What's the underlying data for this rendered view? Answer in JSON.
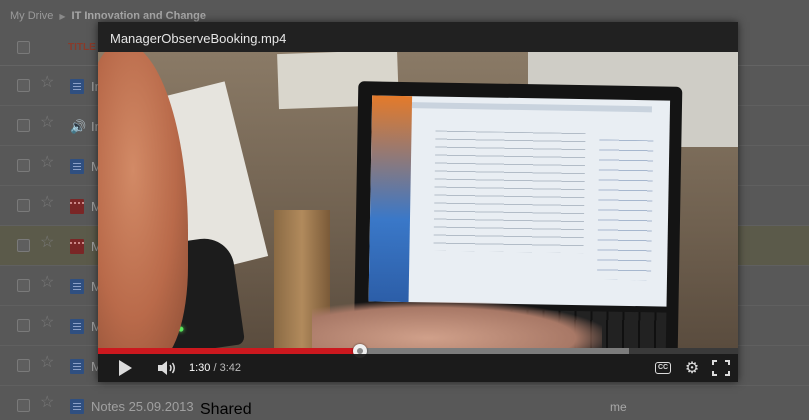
{
  "drive": {
    "breadcrumb": {
      "root": "My Drive",
      "folder": "IT Innovation and Change"
    },
    "columns": {
      "title": "TITLE"
    },
    "rows": [
      {
        "type": "doc",
        "name": "In",
        "shared": "",
        "owner": ""
      },
      {
        "type": "audio",
        "name": "In",
        "shared": "",
        "owner": ""
      },
      {
        "type": "doc",
        "name": "M",
        "shared": "",
        "owner": ""
      },
      {
        "type": "video",
        "name": "M",
        "shared": "",
        "owner": ""
      },
      {
        "type": "video",
        "name": "M",
        "shared": "",
        "owner": ""
      },
      {
        "type": "doc",
        "name": "M",
        "shared": "",
        "owner": ""
      },
      {
        "type": "doc",
        "name": "M",
        "shared": "",
        "owner": ""
      },
      {
        "type": "doc",
        "name": "M",
        "shared": "",
        "owner": ""
      },
      {
        "type": "doc",
        "name": "Notes 25.09.2013",
        "shared": "Shared",
        "owner": "me"
      }
    ]
  },
  "player": {
    "title": "ManagerObserveBooking.mp4",
    "current_time": "1:30",
    "duration": " / 3:42",
    "progress_played_fraction": 0.41,
    "progress_buffered_fraction": 0.83,
    "cc_label": "CC",
    "colors": {
      "played": "#cc181e",
      "buffered": "#7c7c7c"
    },
    "icons": [
      "play-icon",
      "volume-icon",
      "closed-captions-icon",
      "gear-icon",
      "fullscreen-icon"
    ]
  }
}
